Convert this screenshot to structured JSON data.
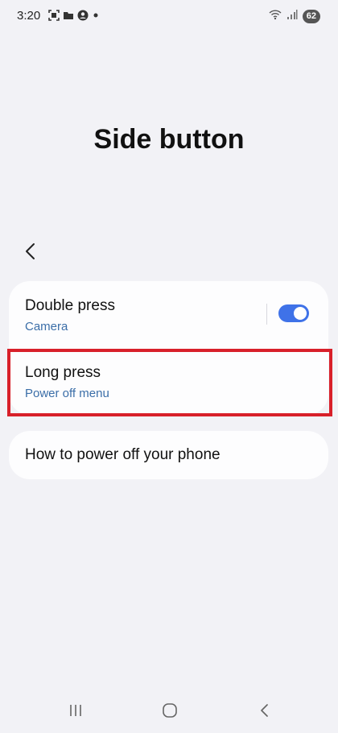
{
  "status_bar": {
    "time": "3:20",
    "battery": "62",
    "left_icons": [
      "screenshot-icon",
      "folder-icon",
      "account-icon",
      "dot-icon"
    ],
    "right_icons": [
      "wifi-icon",
      "signal-icon",
      "battery-icon"
    ]
  },
  "page": {
    "title": "Side button"
  },
  "settings": {
    "double_press": {
      "label": "Double press",
      "value": "Camera",
      "enabled": true
    },
    "long_press": {
      "label": "Long press",
      "value": "Power off menu"
    },
    "how_to": {
      "label": "How to power off your phone"
    }
  },
  "colors": {
    "background": "#f2f2f6",
    "card": "#fdfdfe",
    "accent": "#3f72e8",
    "subtitle": "#3b6ea8",
    "highlight": "#d8202a"
  },
  "nav_bar": {
    "buttons": [
      "recents-icon",
      "home-icon",
      "back-icon"
    ]
  }
}
